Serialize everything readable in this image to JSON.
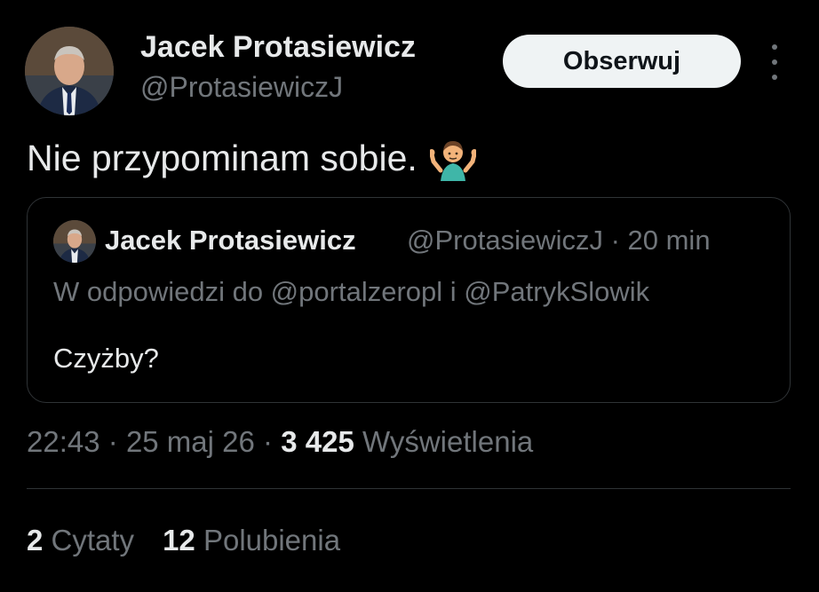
{
  "author": {
    "name": "Jacek Protasiewicz",
    "handle": "@ProtasiewiczJ",
    "avatar_icon": "profile-photo"
  },
  "follow_button": {
    "label": "Obserwuj"
  },
  "more_menu": {
    "icon": "more-vertical-icon"
  },
  "tweet": {
    "text": "Nie przypominam sobie.",
    "emoji": "person-shrugging-emoji"
  },
  "quoted": {
    "name": "Jacek Protasiewicz",
    "handle_time": "@ProtasiewiczJ · 20 min",
    "reply_to": "W odpowiedzi do @portalzeropl i @PatrykSlowik",
    "text": "Czyżby?"
  },
  "meta": {
    "time": "22:43",
    "date": "25 maj 26",
    "views_count": "3 425",
    "views_label": "Wyświetlenia"
  },
  "stats": {
    "quotes_count": "2",
    "quotes_label": "Cytaty",
    "likes_count": "12",
    "likes_label": "Polubienia"
  },
  "colors": {
    "background": "#000000",
    "text": "#e7e9ea",
    "secondary": "#71767b",
    "border": "#2f3336",
    "button": "#eff3f4"
  }
}
